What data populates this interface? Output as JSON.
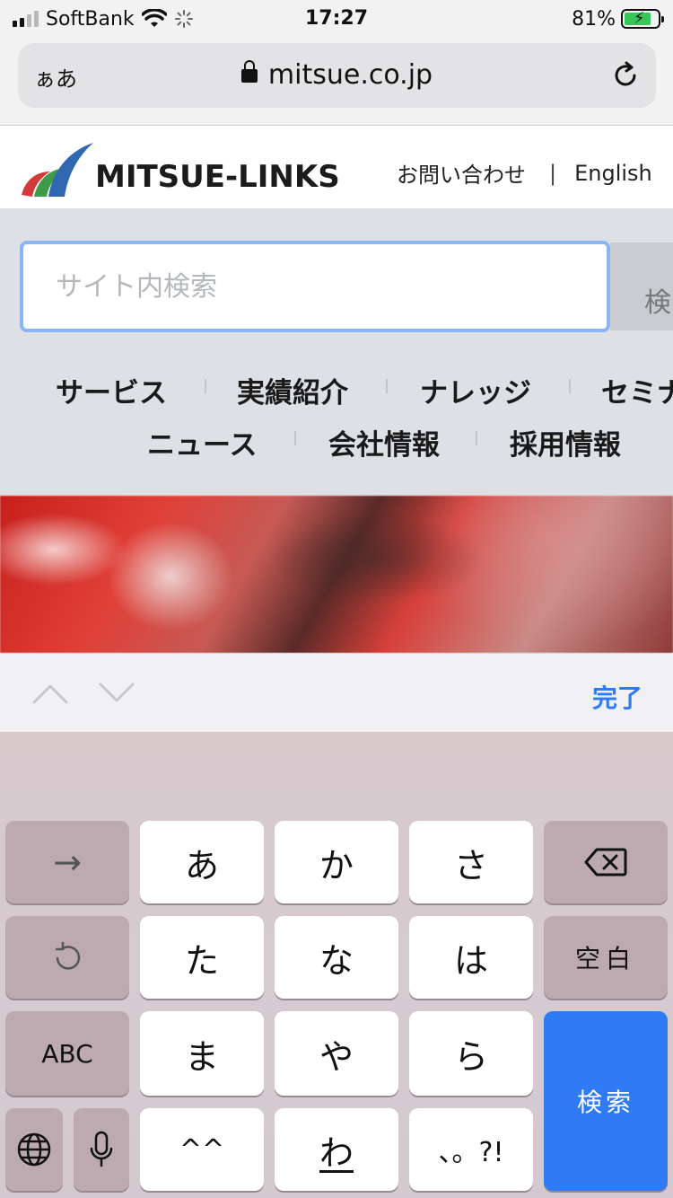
{
  "status_bar": {
    "carrier": "SoftBank",
    "time": "17:27",
    "battery_percent_label": "81%",
    "battery_level": 0.81,
    "signal_bars": 4,
    "signal_bars_filled": 2
  },
  "browser": {
    "text_size_button": "ぁあ",
    "url": "mitsue.co.jp"
  },
  "site": {
    "logo_text": "MITSUE-LINKS",
    "contact_link": "お問い合わせ",
    "separator": "|",
    "english_link": "English",
    "search": {
      "placeholder": "サイト内検索",
      "value": "",
      "button_label": "検"
    },
    "nav_row1": [
      "サービス",
      "実績紹介",
      "ナレッジ",
      "セミナ"
    ],
    "nav_row2": [
      "ニュース",
      "会社情報",
      "採用情報"
    ]
  },
  "accessory_bar": {
    "done_label": "完了"
  },
  "keyboard": {
    "arrow_key": "→",
    "backspace": "⌫",
    "row1": [
      "あ",
      "か",
      "さ"
    ],
    "row2": [
      "た",
      "な",
      "は"
    ],
    "space_label": "空白",
    "abc_label": "ABC",
    "row3": [
      "ま",
      "や",
      "ら"
    ],
    "return_label": "検索",
    "row4": [
      "^^",
      "わ",
      "、。?!"
    ]
  },
  "colors": {
    "accent_blue": "#2f7bf6",
    "focus_ring": "#8ab6f5",
    "band_gray": "#dde1e5",
    "battery_green": "#35c759",
    "logo_red": "#d23a3a",
    "logo_green": "#3f9a4a",
    "logo_blue": "#2f67b1"
  }
}
